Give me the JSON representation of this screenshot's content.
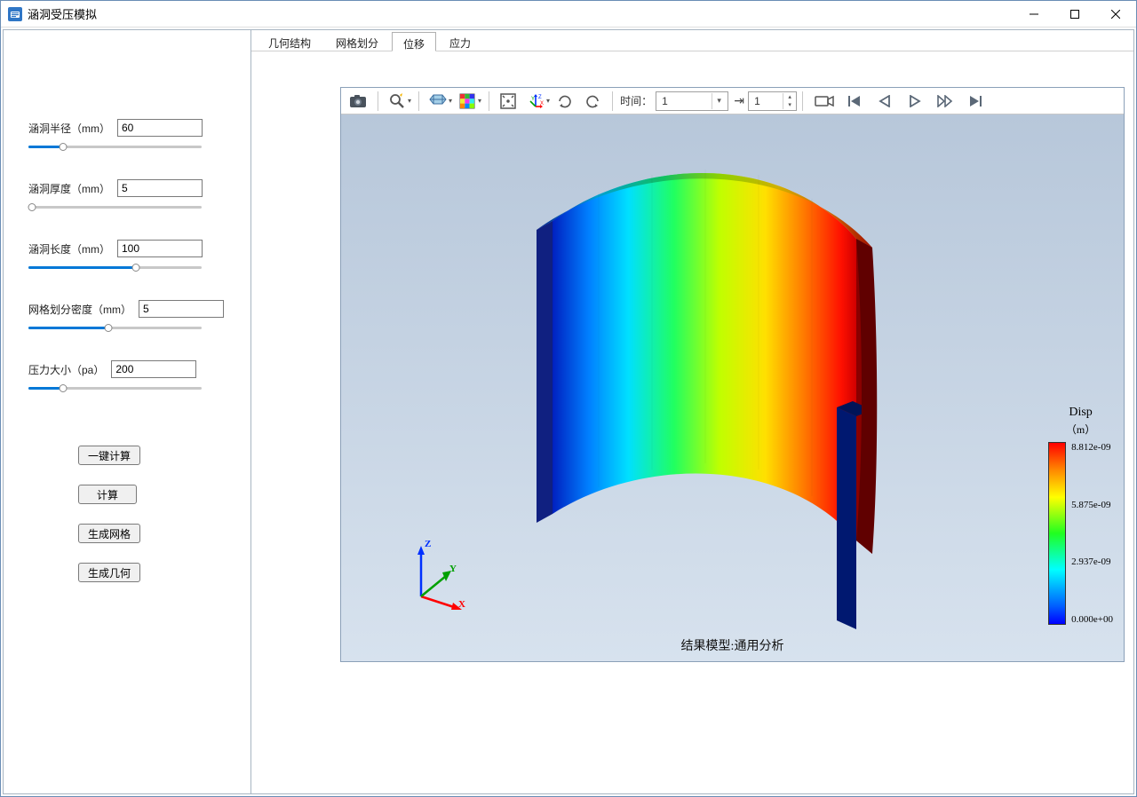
{
  "window": {
    "title": "涵洞受压模拟"
  },
  "sidebar": {
    "params": [
      {
        "label": "涵洞半径（mm）",
        "value": "60",
        "fill_pct": 20
      },
      {
        "label": "涵洞厚度（mm）",
        "value": "5",
        "fill_pct": 2
      },
      {
        "label": "涵洞长度（mm）",
        "value": "100",
        "fill_pct": 62
      },
      {
        "label": "网格划分密度（mm）",
        "value": "5",
        "fill_pct": 46
      },
      {
        "label": "压力大小（pa）",
        "value": "200",
        "fill_pct": 20
      }
    ],
    "buttons": {
      "one_click": "一键计算",
      "compute": "计算",
      "gen_mesh": "生成网格",
      "gen_geom": "生成几何"
    }
  },
  "tabs": [
    {
      "label": "几何结构",
      "active": false
    },
    {
      "label": "网格划分",
      "active": false
    },
    {
      "label": "位移",
      "active": true
    },
    {
      "label": "应力",
      "active": false
    }
  ],
  "toolbar": {
    "time_label": "时间：",
    "time_value": "1",
    "step_value": "1"
  },
  "triad": {
    "x": "X",
    "y": "Y",
    "z": "Z"
  },
  "result_label": "结果模型:通用分析",
  "legend": {
    "title": "Disp",
    "unit": "（m）",
    "ticks": [
      "8.812e-09",
      "5.875e-09",
      "2.937e-09",
      "0.000e+00"
    ]
  }
}
